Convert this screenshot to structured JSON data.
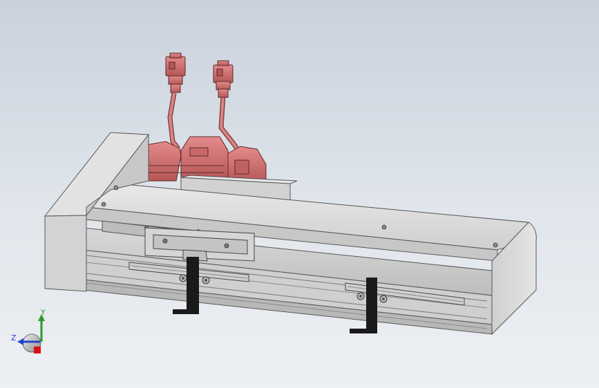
{
  "viewport": {
    "background_top": "#c9d1dc",
    "background_bottom": "#edf0f3"
  },
  "model": {
    "motor_color": "#d06d6d",
    "rail_color": "#dcdcdc",
    "handle_color": "#1a1a1a"
  },
  "triad": {
    "x_label": "",
    "y_label": "Y",
    "z_label": "Z",
    "x_color": "#d11",
    "y_color": "#2a9a2a",
    "z_color": "#2244cc"
  }
}
